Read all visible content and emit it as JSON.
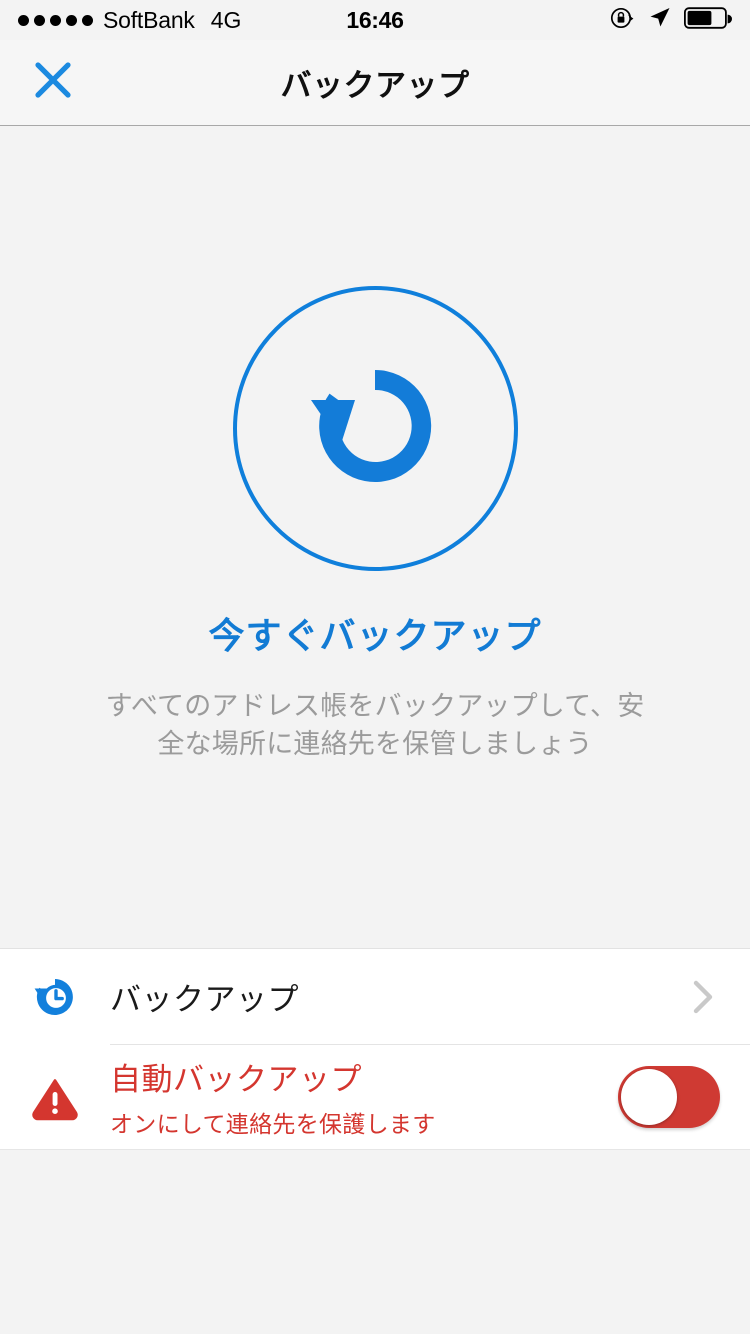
{
  "status_bar": {
    "signal_dots": 5,
    "carrier": "SoftBank",
    "network": "4G",
    "time": "16:46",
    "icons": [
      "rotation-lock-icon",
      "location-arrow-icon",
      "battery-icon"
    ],
    "battery_level_percent": 62
  },
  "nav": {
    "close_icon": "close-icon",
    "title": "バックアップ"
  },
  "hero": {
    "icon": "backup-restore-icon",
    "title": "今すぐバックアップ",
    "subtitle": "すべてのアドレス帳をバックアップして、安全な場所に連絡先を保管しましょう"
  },
  "list": {
    "rows": [
      {
        "icon": "backup-history-icon",
        "title": "バックアップ",
        "accessory": "chevron-right-icon"
      },
      {
        "icon": "warning-triangle-icon",
        "title": "自動バックアップ",
        "subtitle": "オンにして連絡先を保護します",
        "accessory": "toggle-switch",
        "toggle_on": false
      }
    ]
  },
  "colors": {
    "accent_blue": "#0f7fdb",
    "alert_red": "#d4362f",
    "toggle_red": "#cf3a33",
    "page_background": "#f3f3f3",
    "muted_text": "#9b9b9b"
  }
}
